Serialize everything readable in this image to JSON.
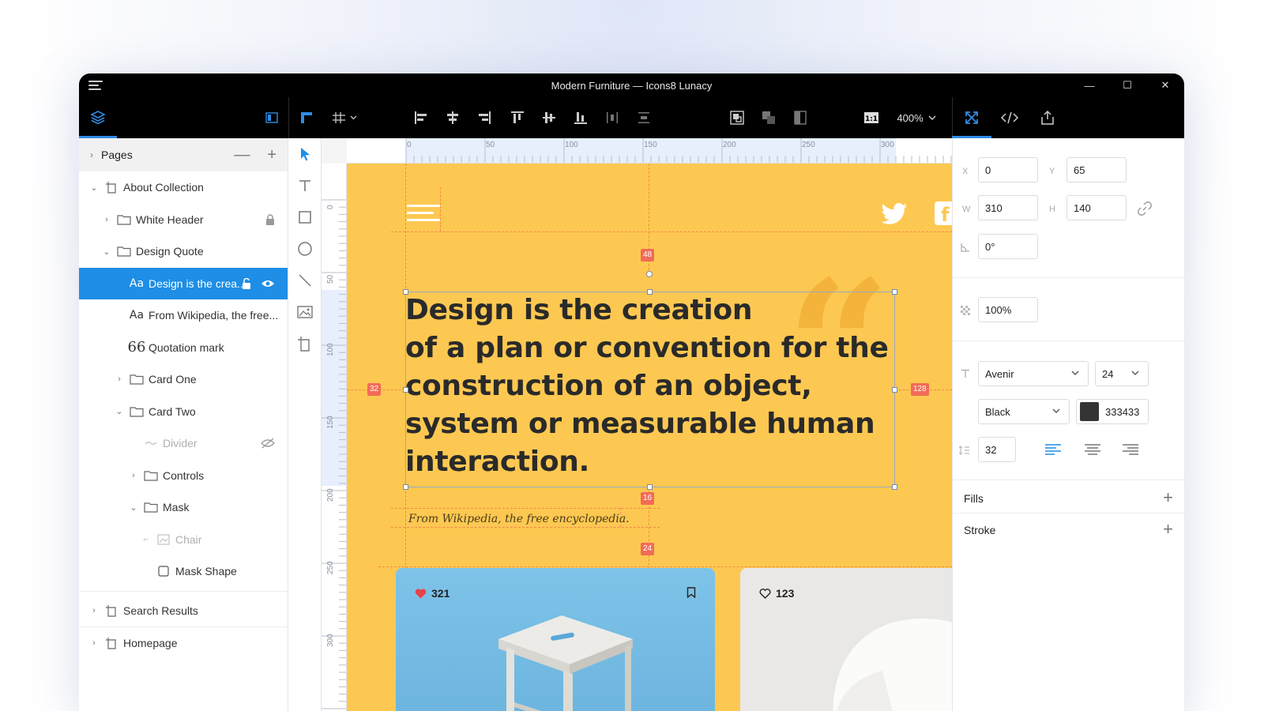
{
  "window": {
    "title": "Modern Furniture — Icons8 Lunacy",
    "minimize": "—",
    "maximize": "☐",
    "close": "✕"
  },
  "toolbar": {
    "zoom": "400%"
  },
  "pages": {
    "header": "Pages",
    "items": [
      {
        "label": "About Collection",
        "level": 0,
        "type": "page",
        "expanded": true
      },
      {
        "label": "White Header",
        "level": 1,
        "type": "folder",
        "expanded": false,
        "locked": true
      },
      {
        "label": "Design Quote",
        "level": 1,
        "type": "folder",
        "expanded": true
      },
      {
        "label": "Design is the crea...",
        "level": 2,
        "type": "text",
        "selected": true
      },
      {
        "label": "From Wikipedia, the free...",
        "level": 2,
        "type": "text"
      },
      {
        "label": "Quotation mark",
        "level": 2,
        "type": "vector"
      },
      {
        "label": "Card One",
        "level": 2,
        "type": "folder",
        "expanded": false
      },
      {
        "label": "Card Two",
        "level": 2,
        "type": "folder",
        "expanded": true
      },
      {
        "label": "Divider",
        "level": 3,
        "type": "line",
        "hidden": true
      },
      {
        "label": "Controls",
        "level": 3,
        "type": "folder",
        "expanded": false
      },
      {
        "label": "Mask",
        "level": 3,
        "type": "folder",
        "expanded": true
      },
      {
        "label": "Chair",
        "level": 4,
        "type": "image",
        "dim": true
      },
      {
        "label": "Mask Shape",
        "level": 4,
        "type": "shape"
      }
    ],
    "other_pages": [
      "Search Results",
      "Homepage"
    ]
  },
  "rulers": {
    "top": [
      "0",
      "50",
      "100",
      "150",
      "200",
      "250",
      "300"
    ],
    "left": [
      "0",
      "50",
      "100",
      "150",
      "200",
      "250",
      "300"
    ]
  },
  "artboard": {
    "quote": "Design is the creation of a plan or convention for the construction of an object, system or measurable human interaction.",
    "quote_lines": [
      "Design is the creation",
      "of a plan or convention for the",
      "construction of an object,",
      "system or measurable human",
      "interaction."
    ],
    "citation": "From Wikipedia, the free encyclopedia.",
    "spacing": {
      "top": "48",
      "left": "32",
      "right": "128",
      "bottom": "16",
      "below": "24"
    },
    "cards": [
      {
        "count": "321"
      },
      {
        "count": "123"
      }
    ],
    "colors": {
      "background": "#fdc851",
      "text": "#333433",
      "accent": "#f26b57"
    }
  },
  "properties": {
    "x_label": "X",
    "x": "0",
    "y_label": "Y",
    "y": "65",
    "w_label": "W",
    "w": "310",
    "h_label": "H",
    "h": "140",
    "rotation": "0°",
    "opacity": "100%",
    "font_family": "Avenir",
    "font_size": "24",
    "font_weight": "Black",
    "color_hex": "333433",
    "line_height": "32",
    "fills": "Fills",
    "stroke": "Stroke"
  }
}
